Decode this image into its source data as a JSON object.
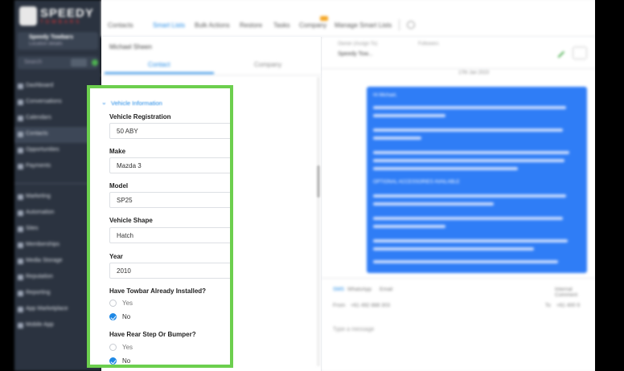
{
  "sidebar": {
    "logo_text": "SPEEDY",
    "logo_sub": "TOWBARS",
    "account_name": "Speedy Towbars",
    "account_sub": "Location details",
    "search_label": "Search",
    "nav": [
      {
        "label": "Dashboard"
      },
      {
        "label": "Conversations"
      },
      {
        "label": "Calendars"
      },
      {
        "label": "Contacts"
      },
      {
        "label": "Opportunities"
      },
      {
        "label": "Payments"
      },
      {
        "label": "Marketing"
      },
      {
        "label": "Automation"
      },
      {
        "label": "Sites"
      },
      {
        "label": "Memberships"
      },
      {
        "label": "Media Storage"
      },
      {
        "label": "Reputation"
      },
      {
        "label": "Reporting"
      },
      {
        "label": "App Marketplace"
      },
      {
        "label": "Mobile App"
      }
    ]
  },
  "topnav": {
    "tabs": [
      "Contacts",
      "Smart Lists",
      "Bulk Actions",
      "Restore",
      "Tasks",
      "Company",
      "Manage Smart Lists"
    ]
  },
  "contact": {
    "name": "Michael Sheen",
    "tabs": [
      "Contact",
      "Company"
    ]
  },
  "form": {
    "section_title": "Vehicle Information",
    "fields": [
      {
        "label": "Vehicle Registration",
        "value": "50 ABY"
      },
      {
        "label": "Make",
        "value": "Mazda 3"
      },
      {
        "label": "Model",
        "value": "SP25"
      },
      {
        "label": "Vehicle Shape",
        "value": "Hatch"
      },
      {
        "label": "Year",
        "value": "2010"
      }
    ],
    "towbar": {
      "label": "Have Towbar Already Installed?",
      "options": [
        "Yes",
        "No"
      ],
      "selected": "No"
    },
    "rear_step": {
      "label": "Have Rear Step Or Bumper?",
      "options": [
        "Yes",
        "No"
      ],
      "selected": "No"
    }
  },
  "conversation": {
    "assign_label": "Owner (Assign To)",
    "assign_value": "Speedy Tow...",
    "followers_label": "Followers",
    "date": "17th Jan 2023",
    "bubble_greeting": "Hi Michael,",
    "bubble_heading": "OPTIONAL ACCESSORIES AVAILABLE",
    "compose_tabs": [
      "SMS",
      "WhatsApp",
      "Email"
    ],
    "internal_label": "Internal Comment",
    "from_label": "From",
    "from_value": "+61 492 888 303",
    "to_label": "To",
    "to_value": "+61 400 9",
    "placeholder": "Type a message"
  },
  "colors": {
    "accent": "#1e88e5",
    "highlight": "#6ccf4e",
    "sidebar": "#2b3340"
  }
}
